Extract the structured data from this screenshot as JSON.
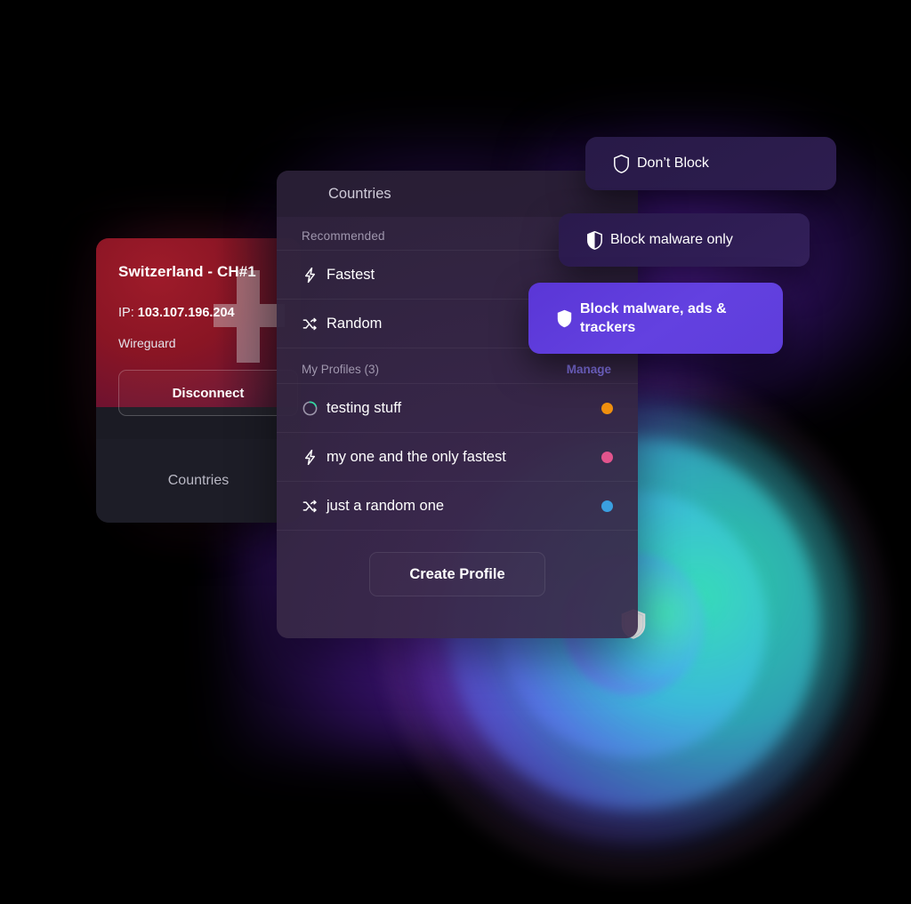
{
  "vpn_card": {
    "server_title": "Switzerland - CH#1",
    "ip_label": "IP:",
    "ip_value": "103.107.196.204",
    "protocol": "Wireguard",
    "disconnect_label": "Disconnect",
    "footer_label": "Countries",
    "flag_icon": "swiss-flag"
  },
  "main_panel": {
    "header_title": "Countries",
    "recommended_label": "Recommended",
    "recommended_items": [
      {
        "label": "Fastest",
        "icon": "lightning-bolt-icon"
      },
      {
        "label": "Random",
        "icon": "shuffle-icon"
      }
    ],
    "profiles_label": "My Profiles (3)",
    "manage_label": "Manage",
    "profiles": [
      {
        "label": "testing stuff",
        "icon": "progress-ring-icon",
        "dot_color": "#f0900f"
      },
      {
        "label": "my one and the only fastest",
        "icon": "lightning-bolt-icon",
        "dot_color": "#e2548d"
      },
      {
        "label": "just a random one",
        "icon": "shuffle-icon",
        "dot_color": "#3a9fe0"
      }
    ],
    "create_profile_label": "Create Profile"
  },
  "block_cards": [
    {
      "label": "Don’t Block",
      "icon": "shield-outline-icon",
      "selected": false
    },
    {
      "label": "Block malware only",
      "icon": "shield-half-icon",
      "selected": false
    },
    {
      "label": "Block malware, ads & trackers",
      "icon": "shield-filled-icon",
      "selected": true
    }
  ],
  "hero_graphic": {
    "center_icon": "shield-filled-icon",
    "ring_colors": [
      "#3ee2c0",
      "#3cc0de",
      "#6068e6",
      "#9246d2"
    ]
  },
  "colors": {
    "accent_purple": "#5e3ddb",
    "manage_link": "#8273e6",
    "panel_bg": "#342642",
    "page_bg": "#000000"
  }
}
